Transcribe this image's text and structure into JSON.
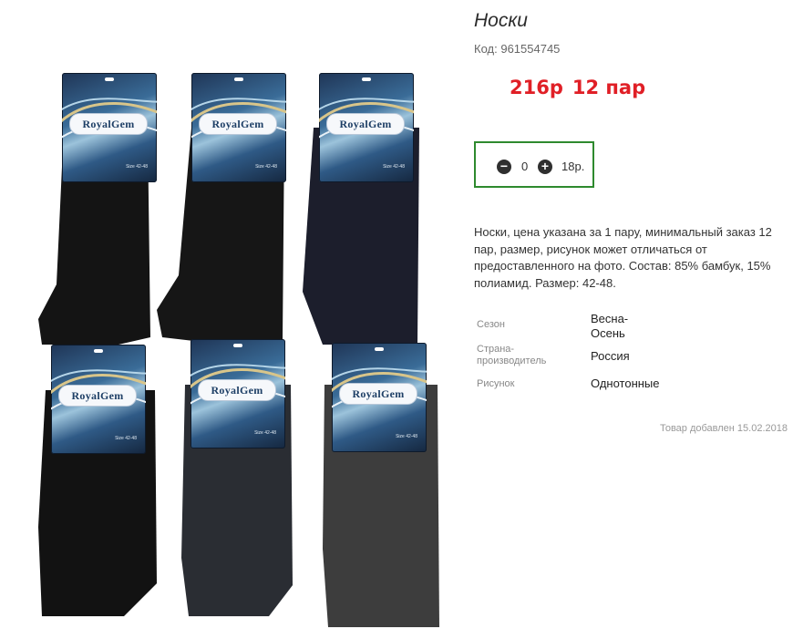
{
  "product": {
    "title": "Носки",
    "code_label": "Код:",
    "code_value": "961554745",
    "price_per_pair": "216р",
    "price_pack": "12 пар"
  },
  "quantity": {
    "minus_icon": "minus-circle-icon",
    "plus_icon": "plus-circle-icon",
    "value": "0",
    "unit_price": "18р."
  },
  "description": "Носки, цена указана за 1 пару, минимальный заказ 12 пар, размер, рисунок может отличаться от предоставленного на фото. Состав: 85% бамбук, 15% полиамид. Размер: 42-48.",
  "properties": [
    {
      "label": "Сезон",
      "value": "Весна-\nОсень"
    },
    {
      "label": "Страна-\nпроизводитель",
      "value": "Россия"
    },
    {
      "label": "Рисунок",
      "value": "Однотонные"
    }
  ],
  "added_date": "Товар добавлен 15.02.2018",
  "image": {
    "brand_logo": "RoyalGem",
    "tag_size": "Size 42-48",
    "colors": {
      "price_red": "#e01f26",
      "qty_border_green": "#2e8a2e",
      "sock_black": "#141414",
      "sock_navy": "#1c1e2c",
      "sock_graphite": "#2a2d33",
      "sock_dark_gray": "#3d3d3d"
    }
  }
}
